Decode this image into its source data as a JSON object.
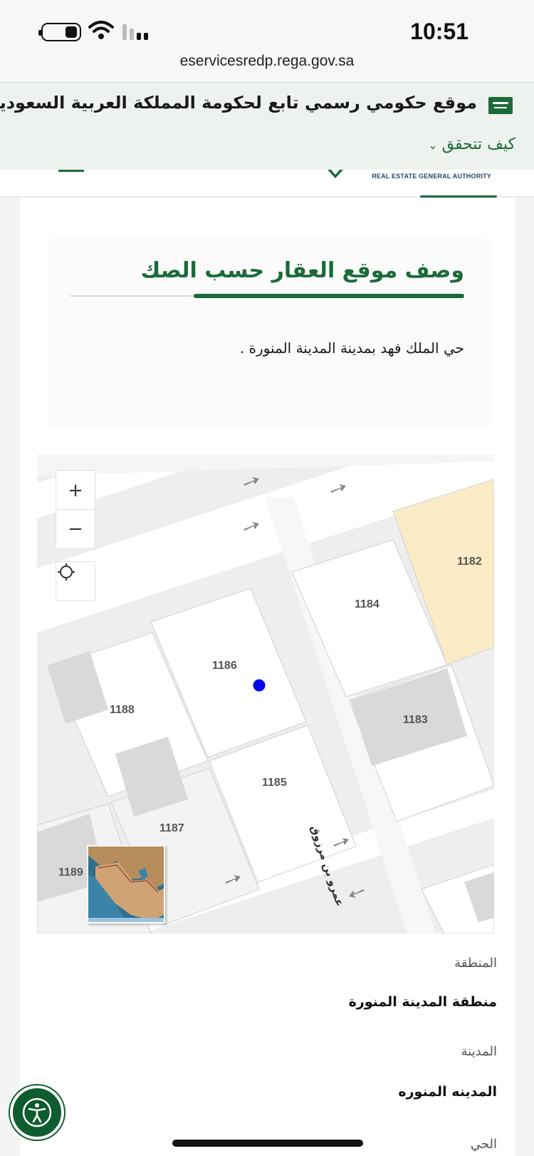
{
  "status_bar": {
    "time": "10:51"
  },
  "browser": {
    "url": "eservicesredp.rega.gov.sa"
  },
  "gov_banner": {
    "official_text": "موقع حكومي رسمي تابع لحكومة المملكة العربية السعودية",
    "verify_label": "كيف تتحقق",
    "flag_icon": "saudi-flag-icon"
  },
  "header": {
    "org_name_en": "REAL ESTATE GENERAL AUTHORITY"
  },
  "location_card": {
    "title": "وصف موقع العقار حسب الصك",
    "description": "حي الملك فهد بمدينة المدينة المنورة ."
  },
  "map": {
    "zoom_in": "+",
    "zoom_out": "−",
    "locate_icon": "crosshair-icon",
    "parcels": [
      "1182",
      "1184",
      "1186",
      "1183",
      "1188",
      "1185",
      "1187",
      "1189"
    ],
    "street_name": "عمرو بن مرزوق",
    "colors": {
      "highlight_parcel": "#fbecc8",
      "marker": "#0000ee",
      "building": "#d9d9d9"
    }
  },
  "details": [
    {
      "label": "المنطقة",
      "value": "منطقة المدينة المنورة"
    },
    {
      "label": "المدينة",
      "value": "المدينه المنوره"
    },
    {
      "label": "الحي",
      "value": ""
    }
  ],
  "colors": {
    "brand_green": "#1b6b3a",
    "accessibility_button": "#0f5c2e"
  }
}
